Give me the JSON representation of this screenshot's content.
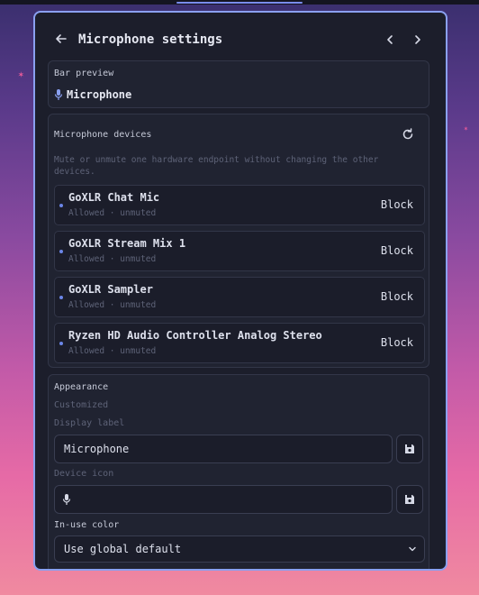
{
  "window": {
    "title": "Microphone settings"
  },
  "bar_preview": {
    "label": "Bar preview",
    "value": "Microphone"
  },
  "devices": {
    "label": "Microphone devices",
    "description": "Mute or unmute one hardware endpoint without changing the other devices.",
    "items": [
      {
        "name": "GoXLR Chat Mic",
        "status": "Allowed · unmuted",
        "action": "Block"
      },
      {
        "name": "GoXLR Stream Mix 1",
        "status": "Allowed · unmuted",
        "action": "Block"
      },
      {
        "name": "GoXLR Sampler",
        "status": "Allowed · unmuted",
        "action": "Block"
      },
      {
        "name": "Ryzen HD Audio Controller Analog Stereo",
        "status": "Allowed · unmuted",
        "action": "Block"
      }
    ]
  },
  "appearance": {
    "label": "Appearance",
    "state": "Customized",
    "display_label": {
      "label": "Display label",
      "value": "Microphone"
    },
    "device_icon": {
      "label": "Device icon",
      "value": "microphone-icon"
    },
    "in_use_color": {
      "label": "In-use color",
      "value": "Use global default"
    }
  },
  "colors": {
    "accent": "#8aa0f0",
    "panel": "#1c1e2b",
    "dot": "#6b86e8"
  }
}
